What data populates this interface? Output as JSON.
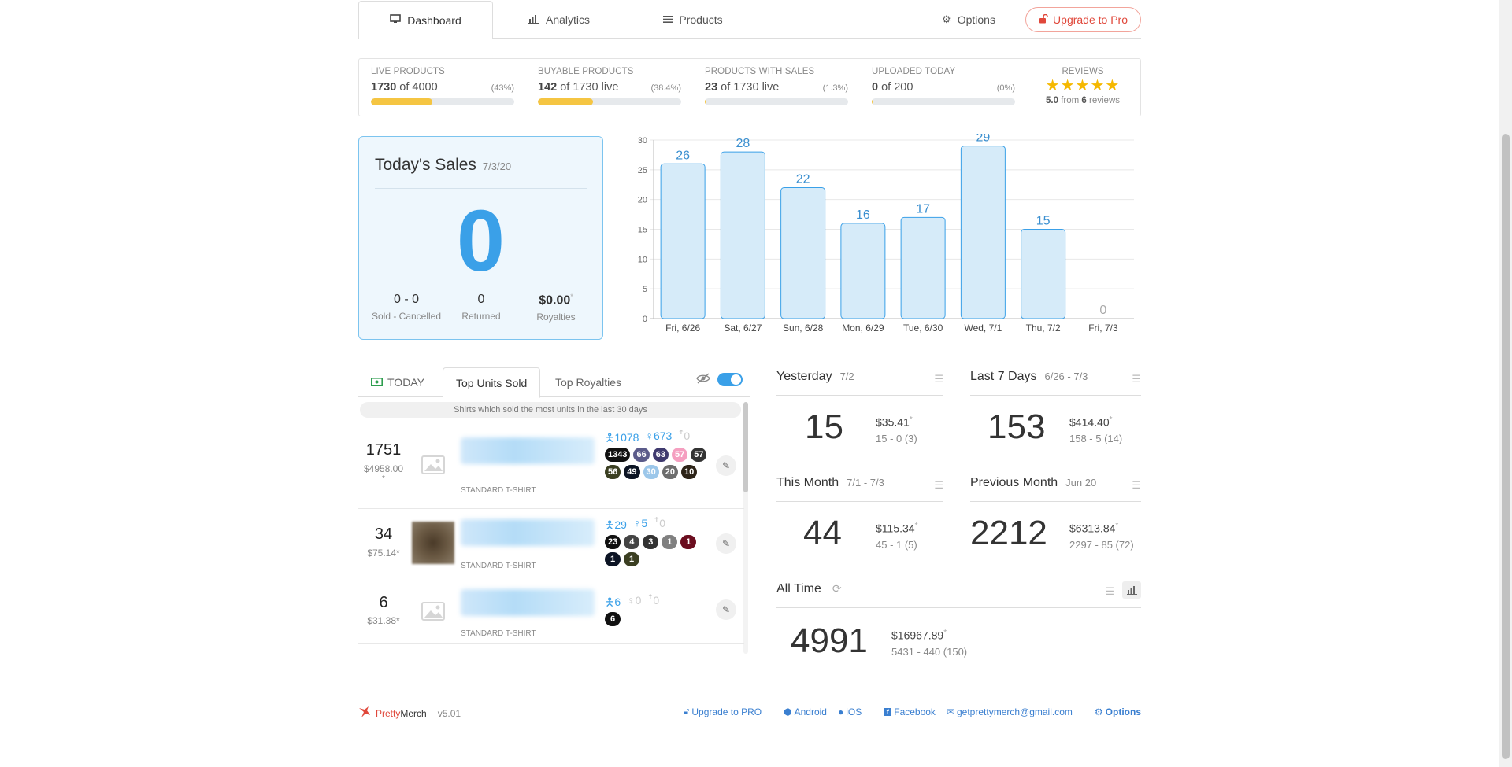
{
  "tabs": {
    "dashboard": "Dashboard",
    "analytics": "Analytics",
    "products": "Products",
    "options": "Options",
    "upgrade": "Upgrade to Pro"
  },
  "stats": [
    {
      "label": "LIVE PRODUCTS",
      "value": "1730",
      "of": "of 4000",
      "pct": "(43%)",
      "fill": 0.43
    },
    {
      "label": "BUYABLE PRODUCTS",
      "value": "142",
      "of": "of 1730 live",
      "pct": "(38.4%)",
      "fill": 0.384
    },
    {
      "label": "PRODUCTS WITH SALES",
      "value": "23",
      "of": "of 1730 live",
      "pct": "(1.3%)",
      "fill": 0.013
    },
    {
      "label": "UPLOADED TODAY",
      "value": "0",
      "of": "of 200",
      "pct": "(0%)",
      "fill": 0.0
    }
  ],
  "reviews": {
    "label": "REVIEWS",
    "stars": "★★★★★",
    "rating": "5.0",
    "from": "from",
    "count": "6",
    "suffix": "reviews",
    "value": 5
  },
  "today": {
    "title": "Today's Sales",
    "date": "7/3/20",
    "big": "0",
    "sold_value": "0 - 0",
    "sold_label": "Sold - Cancelled",
    "returned_value": "0",
    "returned_label": "Returned",
    "royalties_value": "$0.00",
    "royalties_mark": "*",
    "royalties_label": "Royalties"
  },
  "chart_data": {
    "type": "bar",
    "categories": [
      "Fri, 6/26",
      "Sat, 6/27",
      "Sun, 6/28",
      "Mon, 6/29",
      "Tue, 6/30",
      "Wed, 7/1",
      "Thu, 7/2",
      "Fri, 7/3"
    ],
    "values": [
      26,
      28,
      22,
      16,
      17,
      29,
      15,
      0
    ],
    "yticks": [
      0,
      5,
      10,
      15,
      20,
      25,
      30
    ],
    "ylim": [
      0,
      30
    ],
    "grid": true,
    "bar_color": "#d6ebf9",
    "bar_stroke": "#3aa0e8",
    "label_color": "#3a8fd0"
  },
  "panel": {
    "today_tab": "TODAY",
    "units_tab": "Top Units Sold",
    "royalties_tab": "Top Royalties",
    "note": "Shirts which sold the most units in the last 30 days"
  },
  "items": [
    {
      "units": "1751",
      "money": "$4958.00",
      "mark": "*",
      "type": "STANDARD T-SHIRT",
      "men": "1078",
      "women": "673",
      "youth": "0",
      "badges": [
        {
          "n": "1343",
          "c": "#111111"
        },
        {
          "n": "66",
          "c": "#5b5b8a"
        },
        {
          "n": "63",
          "c": "#3f3a6e"
        },
        {
          "n": "57",
          "c": "#f59fc0"
        },
        {
          "n": "57",
          "c": "#333333"
        },
        {
          "n": "56",
          "c": "#3b3f22"
        },
        {
          "n": "49",
          "c": "#0c1424"
        },
        {
          "n": "30",
          "c": "#9cc7ea"
        },
        {
          "n": "20",
          "c": "#6d6d6d"
        },
        {
          "n": "10",
          "c": "#2d2418"
        }
      ]
    },
    {
      "units": "34",
      "money": "$75.14",
      "mark": "*",
      "type": "STANDARD T-SHIRT",
      "men": "29",
      "women": "5",
      "youth": "0",
      "badges": [
        {
          "n": "23",
          "c": "#111111"
        },
        {
          "n": "4",
          "c": "#444444"
        },
        {
          "n": "3",
          "c": "#333333"
        },
        {
          "n": "1",
          "c": "#808080"
        },
        {
          "n": "1",
          "c": "#6b0d1f"
        },
        {
          "n": "1",
          "c": "#0c1424"
        },
        {
          "n": "1",
          "c": "#3b3f22"
        }
      ]
    },
    {
      "units": "6",
      "money": "$31.38",
      "mark": "*",
      "type": "STANDARD T-SHIRT",
      "men": "6",
      "women": "0",
      "youth": "0",
      "badges": [
        {
          "n": "6",
          "c": "#111111"
        }
      ]
    }
  ],
  "summaries": {
    "yesterday": {
      "title": "Yesterday",
      "date": "7/2",
      "num": "15",
      "money": "$35.41",
      "detail": "15 - 0  (3)"
    },
    "last7": {
      "title": "Last 7 Days",
      "date": "6/26 - 7/3",
      "num": "153",
      "money": "$414.40",
      "detail": "158 - 5  (14)"
    },
    "month": {
      "title": "This Month",
      "date": "7/1 - 7/3",
      "num": "44",
      "money": "$115.34",
      "detail": "45 - 1  (5)"
    },
    "prev": {
      "title": "Previous Month",
      "date": "Jun 20",
      "num": "2212",
      "money": "$6313.84",
      "detail": "2297 - 85  (72)"
    },
    "all": {
      "title": "All Time",
      "num": "4991",
      "money": "$16967.89",
      "detail": "5431 - 440  (150)"
    },
    "mark": "*"
  },
  "footer": {
    "brand_a": "Pretty",
    "brand_b": "Merch",
    "version": "v5.01",
    "upgrade": "Upgrade to PRO",
    "android": "Android",
    "ios": "iOS",
    "facebook": "Facebook",
    "email": "getprettymerch@gmail.com",
    "options": "Options"
  }
}
